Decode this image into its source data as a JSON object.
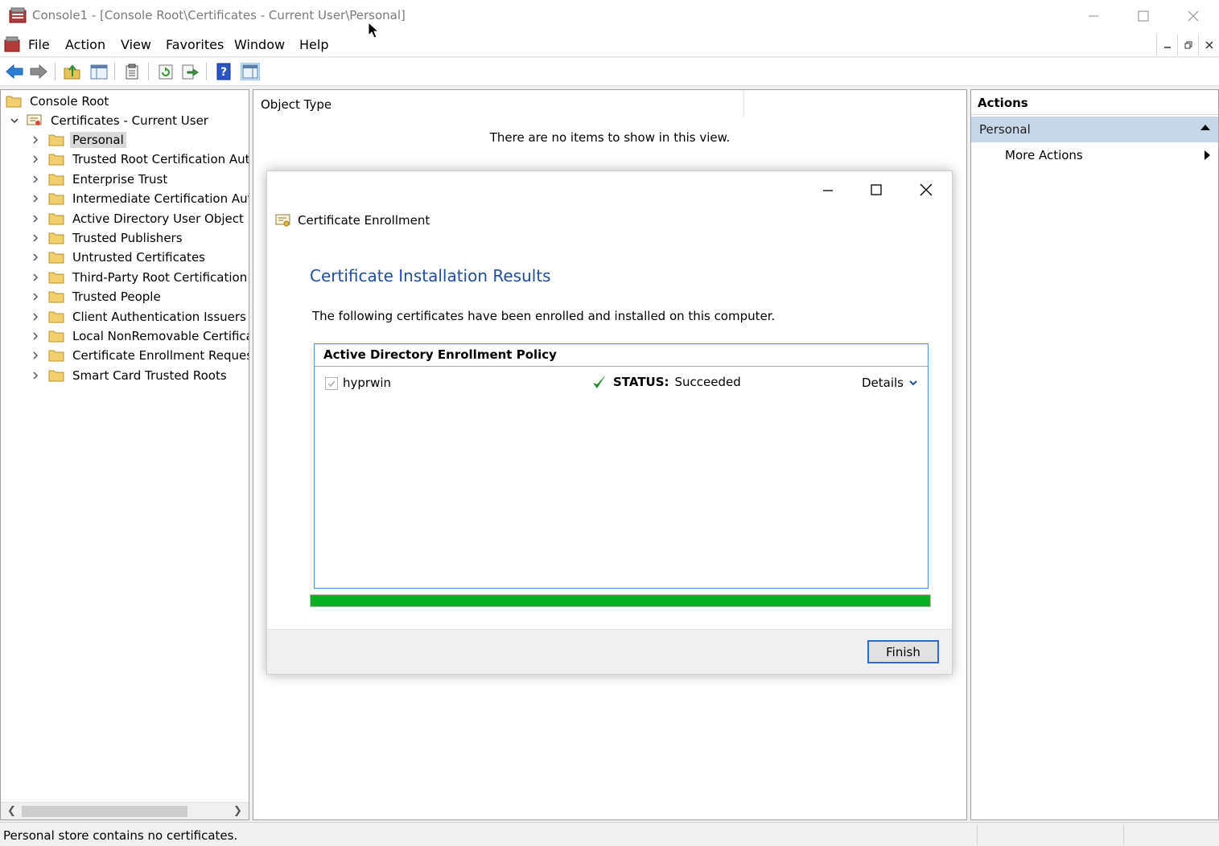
{
  "window": {
    "title": "Console1 - [Console Root\\Certificates - Current User\\Personal]"
  },
  "menu": {
    "items": [
      "File",
      "Action",
      "View",
      "Favorites",
      "Window",
      "Help"
    ]
  },
  "tree": {
    "root": "Console Root",
    "store": "Certificates - Current User",
    "items": [
      "Personal",
      "Trusted Root Certification Auth",
      "Enterprise Trust",
      "Intermediate Certification Auth",
      "Active Directory User Object",
      "Trusted Publishers",
      "Untrusted Certificates",
      "Third-Party Root Certification A",
      "Trusted People",
      "Client Authentication Issuers",
      "Local NonRemovable Certificat",
      "Certificate Enrollment Request:",
      "Smart Card Trusted Roots"
    ]
  },
  "center": {
    "column_header": "Object Type",
    "empty_message": "There are no items to show in this view."
  },
  "actions": {
    "title": "Actions",
    "section": "Personal",
    "more_actions": "More Actions"
  },
  "status_bar": {
    "text": "Personal store contains no certificates."
  },
  "dialog": {
    "header": "Certificate Enrollment",
    "heading": "Certificate Installation Results",
    "description": "The following certificates have been enrolled and installed on this computer.",
    "policy_title": "Active Directory Enrollment Policy",
    "certificate": {
      "name": "hyprwin",
      "status_label": "STATUS:",
      "status_value": "Succeeded",
      "details_label": "Details"
    },
    "progress_fraction": 1.0,
    "progress_color": "#06b025",
    "finish_label": "Finish"
  }
}
